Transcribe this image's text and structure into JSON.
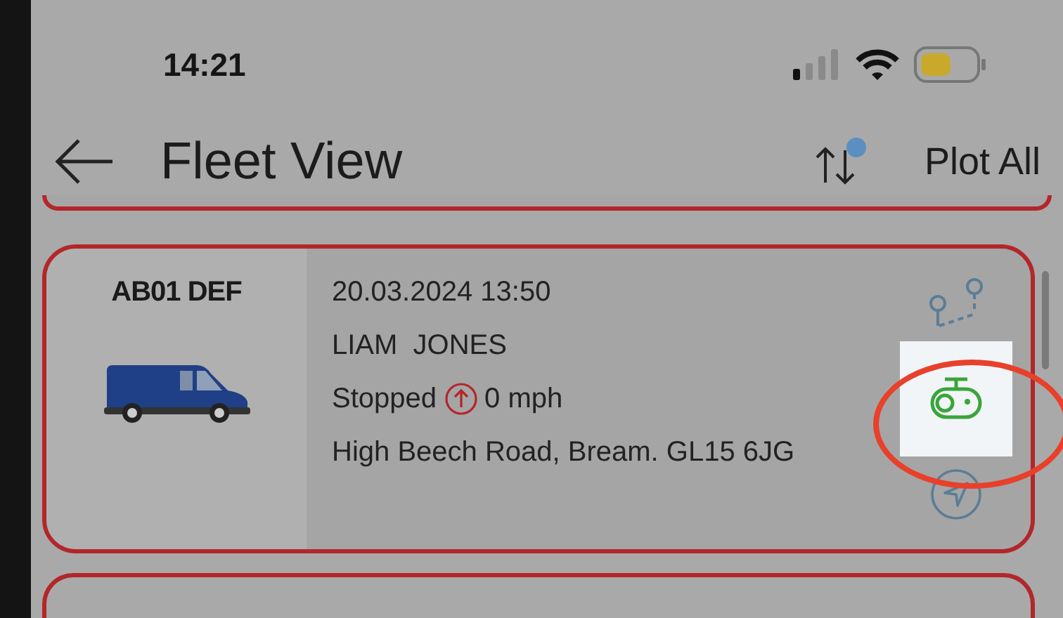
{
  "status_bar": {
    "time": "14:21"
  },
  "header": {
    "title": "Fleet View",
    "action": "Plot All"
  },
  "vehicles": [
    {
      "registration": "AB01 DEF",
      "timestamp": "20.03.2024 13:50",
      "driver": "LIAM  JONES",
      "status": "Stopped",
      "speed": "0 mph",
      "address": "High Beech Road, Bream. GL15 6JG",
      "camera_highlighted": true
    }
  ]
}
